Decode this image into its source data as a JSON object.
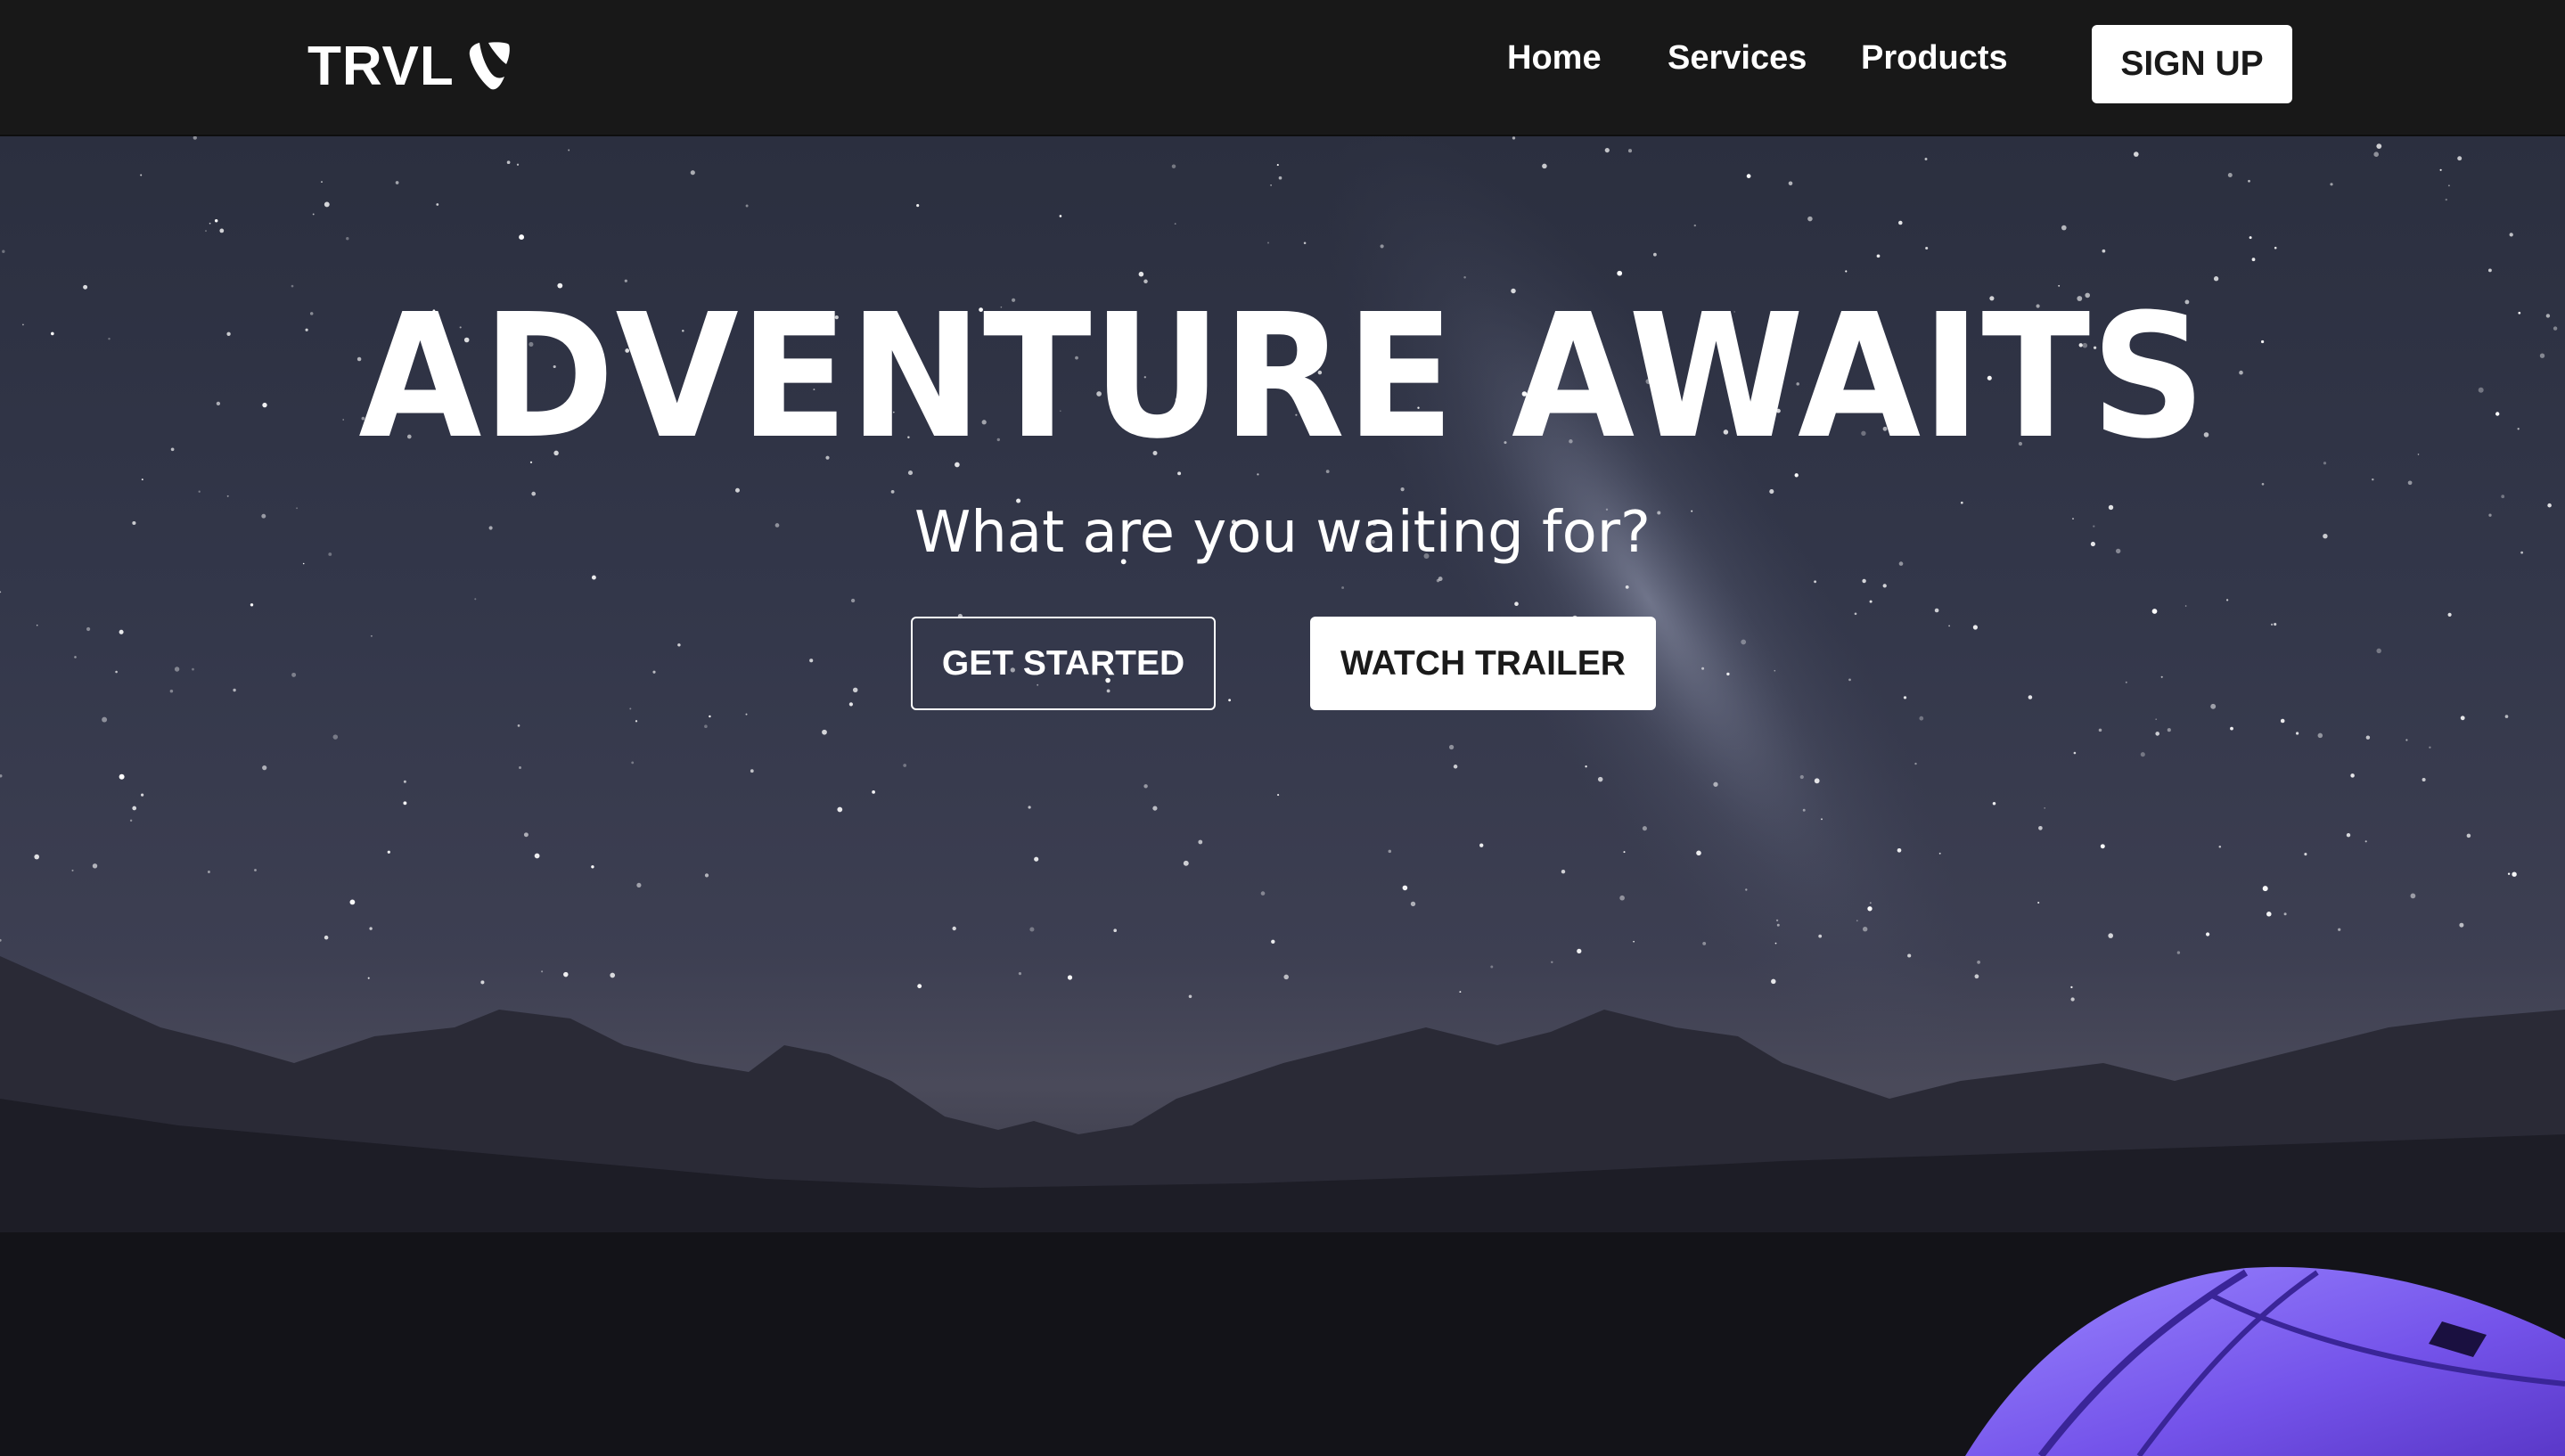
{
  "navbar": {
    "brand_name": "TRVL",
    "brand_icon": "typo3-logo-icon",
    "links": [
      {
        "label": "Home"
      },
      {
        "label": "Services"
      },
      {
        "label": "Products"
      }
    ],
    "signup_label": "SIGN UP"
  },
  "hero": {
    "title": "ADVENTURE AWAITS",
    "subtitle": "What are you waiting for?",
    "primary_button": "GET STARTED",
    "secondary_button": "WATCH TRAILER",
    "background": "night-sky-mountains-tent-image"
  },
  "colors": {
    "navbar_bg": "#181818",
    "text": "#ffffff",
    "button_bg": "#ffffff",
    "button_text": "#1a1a1a",
    "tent": "#7a5cf0"
  }
}
